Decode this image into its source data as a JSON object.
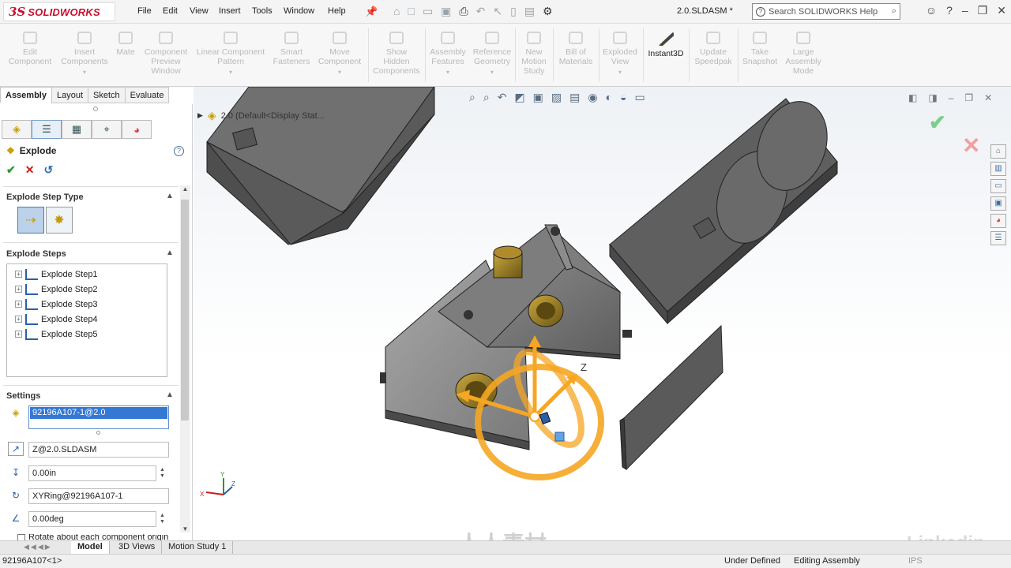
{
  "app": {
    "logo_prefix": "3S",
    "logo_text": "SOLIDWORKS",
    "document_title": "2.0.SLDASM *"
  },
  "menu": [
    "File",
    "Edit",
    "View",
    "Insert",
    "Tools",
    "Window",
    "Help"
  ],
  "search": {
    "placeholder": "Search SOLIDWORKS Help"
  },
  "ribbon": [
    {
      "label": "Edit\nComponent"
    },
    {
      "label": "Insert\nComponents"
    },
    {
      "label": "Mate"
    },
    {
      "label": "Component\nPreview\nWindow"
    },
    {
      "label": "Linear Component\nPattern"
    },
    {
      "label": "Smart\nFasteners"
    },
    {
      "label": "Move\nComponent"
    },
    {
      "label": "Show\nHidden\nComponents"
    },
    {
      "label": "Assembly\nFeatures"
    },
    {
      "label": "Reference\nGeometry"
    },
    {
      "label": "New\nMotion\nStudy"
    },
    {
      "label": "Bill of\nMaterials"
    },
    {
      "label": "Exploded\nView"
    },
    {
      "label": "Instant3D"
    },
    {
      "label": "Update\nSpeedpak"
    },
    {
      "label": "Take\nSnapshot"
    },
    {
      "label": "Large\nAssembly\nMode"
    }
  ],
  "tabs": [
    "Assembly",
    "Layout",
    "Sketch",
    "Evaluate"
  ],
  "panel": {
    "title": "Explode",
    "help": "?",
    "ok_symbol": "✔",
    "cancel_symbol": "✕",
    "sections": {
      "step_type": "Explode Step Type",
      "steps": "Explode Steps",
      "settings": "Settings"
    },
    "steps": [
      "Explode Step1",
      "Explode Step2",
      "Explode Step3",
      "Explode Step4",
      "Explode Step5"
    ],
    "settings": {
      "component": "92196A107-1@2.0",
      "direction": "Z@2.0.SLDASM",
      "distance": "0.00in",
      "rotation_axis": "XYRing@92196A107-1",
      "angle": "0.00deg",
      "rotate_option": "Rotate about each component origin"
    }
  },
  "viewport": {
    "tree_label": "2.0 (Default<Display Stat...",
    "triad_label": "Z",
    "axis_labels": {
      "x": "X",
      "y": "Y",
      "z": "Z"
    }
  },
  "bottom_tabs": [
    "Model",
    "3D Views",
    "Motion Study 1"
  ],
  "status": {
    "left": "92196A107<1>",
    "state": "Under Defined",
    "mode": "Editing Assembly",
    "units": "IPS"
  },
  "watermarks": {
    "site": "人人素材",
    "brand": "Linkedin"
  },
  "colors": {
    "brand_red": "#c8102e",
    "triad_orange": "#f5a623",
    "selection_blue": "#3478d4"
  }
}
